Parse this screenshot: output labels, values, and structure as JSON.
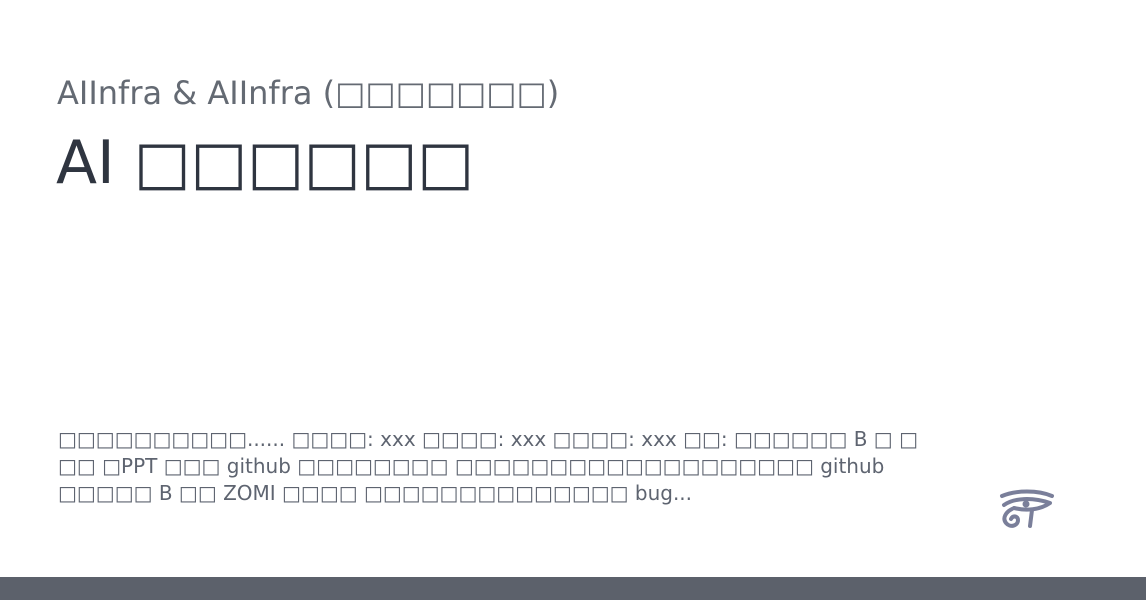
{
  "card": {
    "site_title": "AIInfra & AIInfra (□□□□□□□)",
    "page_title": "AI □□□□□□",
    "description": "□□□□□□□□□□...... □□□□: xxx □□□□: xxx □□□□: xxx □□: □□□□□□ B □ □ □□ □PPT □□□ github □□□□□□□□ □□□□□□□□□□□□□□□□□□□ github □□□□□ B □□ ZOMI □□□□ □□□□□□□□□□□□□□ bug..."
  },
  "logo": {
    "icon": "eye-of-horus-icon",
    "color": "#7a7f9a"
  },
  "colors": {
    "background": "#ffffff",
    "site_title": "#646a73",
    "page_title": "#2f3540",
    "description": "#5e6470",
    "footer_bar": "#5c616b"
  }
}
